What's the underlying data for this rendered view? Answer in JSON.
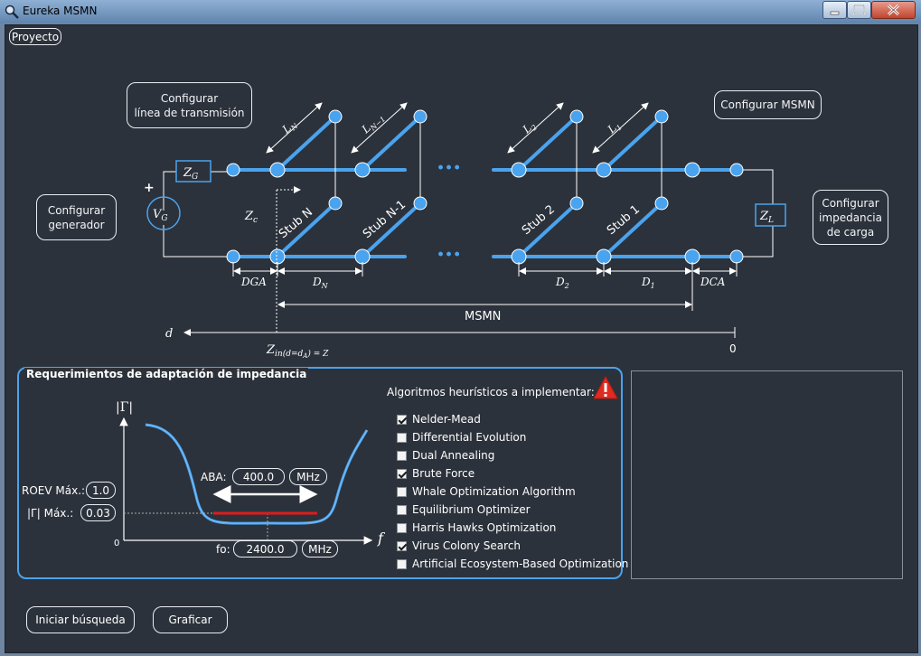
{
  "window": {
    "title": "Eureka MSMN"
  },
  "menu": {
    "proyecto": "Proyecto"
  },
  "buttons": {
    "config_linea_l1": "Configurar",
    "config_linea_l2": "línea de transmisión",
    "config_generador_l1": "Configurar",
    "config_generador_l2": "generador",
    "config_msmn": "Configurar MSMN",
    "config_carga_l1": "Configurar",
    "config_carga_l2": "impedancia",
    "config_carga_l3": "de carga",
    "iniciar": "Iniciar búsqueda",
    "graficar": "Graficar"
  },
  "diagram": {
    "zg": "Z",
    "zg_sub": "G",
    "vg": "V",
    "vg_sub": "G",
    "plus": "+",
    "zl": "Z",
    "zl_sub": "L",
    "zc": "Z",
    "zc_sub": "c",
    "stub_n": "Stub N",
    "stub_n1": "Stub N-1",
    "stub_2": "Stub 2",
    "stub_1": "Stub 1",
    "ln": "L",
    "ln_sub": "N",
    "ln1_sub": "N−1",
    "l2_sub": "2",
    "l1_sub": "1",
    "dga": "DGA",
    "dn": "D",
    "dn_sub": "N",
    "d2_sub": "2",
    "d1_sub": "1",
    "dca": "DCA",
    "msmn": "MSMN",
    "d_axis": "d",
    "zero": "0",
    "zin_expr": "Z",
    "zin_sub": "in(d=d",
    "zin_sub2": "A",
    "zin_tail": ") = Z",
    "zin_tail_sub": "c",
    "ellipsis": "···"
  },
  "requirements": {
    "title": "Requerimientos de adaptación de impedancia",
    "gamma_axis": "|Γ|",
    "f_axis": "f",
    "origin": "0",
    "roev_label": "ROEV Máx.:",
    "roev_value": "1.0",
    "gamma_label": "|Γ| Máx.:",
    "gamma_value": "0.03",
    "aba_label": "ABA:",
    "aba_value": "400.0",
    "aba_unit": "MHz",
    "fo_label": "fo:",
    "fo_value": "2400.0",
    "fo_unit": "MHz"
  },
  "algorithms": {
    "title": "Algoritmos heurísticos a implementar:",
    "items": [
      {
        "label": "Nelder-Mead",
        "checked": true
      },
      {
        "label": "Differential Evolution",
        "checked": false
      },
      {
        "label": "Dual Annealing",
        "checked": false
      },
      {
        "label": "Brute Force",
        "checked": true
      },
      {
        "label": "Whale Optimization Algorithm",
        "checked": false
      },
      {
        "label": "Equilibrium Optimizer",
        "checked": false
      },
      {
        "label": "Harris Hawks Optimization",
        "checked": false
      },
      {
        "label": "Virus Colony Search",
        "checked": true
      },
      {
        "label": "Artificial Ecosystem-Based Optimization",
        "checked": false
      }
    ]
  },
  "colors": {
    "line": "#4aa3ee",
    "background": "#2c323b",
    "warning": "#e02b20",
    "highlight": "#e01b1b"
  }
}
